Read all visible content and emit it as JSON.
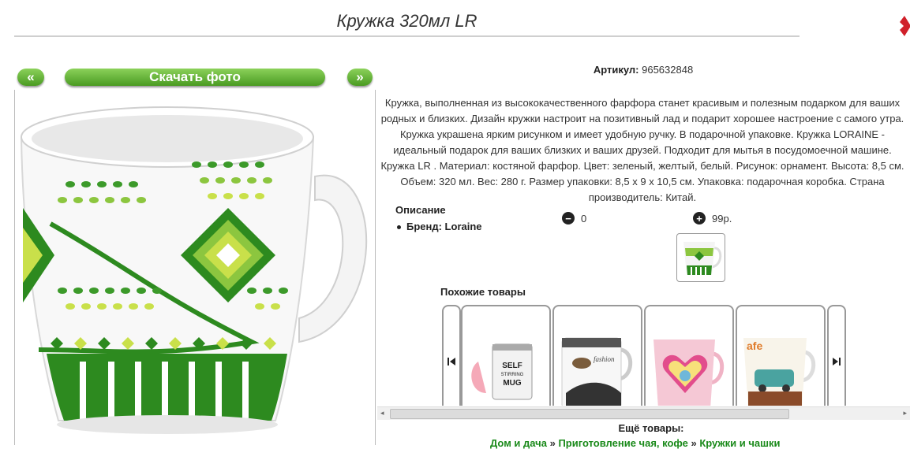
{
  "product": {
    "title": "Кружка 320мл LR",
    "article_label": "Артикул:",
    "article_value": "965632848",
    "description": "Кружка, выполненная из высококачественного фарфора станет красивым и полезным подарком для ваших родных и близких. Дизайн кружки настроит на позитивный лад и подарит хорошее настроение с самого утра. Кружка украшена ярким рисунком и имеет удобную ручку. В подарочной упаковке. Кружка LORAINE - идеальный подарок для ваших близких и ваших друзей. Подходит для мытья в посудомоечной машине. Кружка LR . Материал: костяной фарфор. Цвет: зеленый, желтый, белый. Рисунок: орнамент. Высота: 8,5 см. Объем: 320 мл. Вес: 280 г. Размер упаковки: 8,5 х 9 х 10,5 см. Упаковка: подарочная коробка. Страна производитель: Китай.",
    "specs_title": "Описание",
    "brand_line": "Бренд: Loraine",
    "quantity": "0",
    "price": "99р."
  },
  "photo_nav": {
    "prev": "«",
    "download": "Скачать фото",
    "next": "»"
  },
  "similar": {
    "title": "Похожие товары",
    "items": [
      {
        "name": "self-stirring-mug",
        "print": "SELF STIRRING MUG"
      },
      {
        "name": "fashion-mug",
        "print": "fashion"
      },
      {
        "name": "pink-heart-mug",
        "print": ""
      },
      {
        "name": "cafe-car-mug",
        "print": "afe"
      }
    ]
  },
  "more": {
    "title": "Ещё товары:",
    "crumbs": [
      "Дом и дача",
      "Приготовление чая, кофе",
      "Кружки и чашки"
    ],
    "separator": "»"
  },
  "icons": {
    "close": "close-icon",
    "minus": "minus-circle-icon",
    "plus": "plus-circle-icon",
    "prev": "skip-prev-icon",
    "next": "skip-next-icon"
  },
  "colors": {
    "accent_green": "#4a9b22",
    "close_red": "#d0202a",
    "link_green": "#1a8a1a"
  }
}
